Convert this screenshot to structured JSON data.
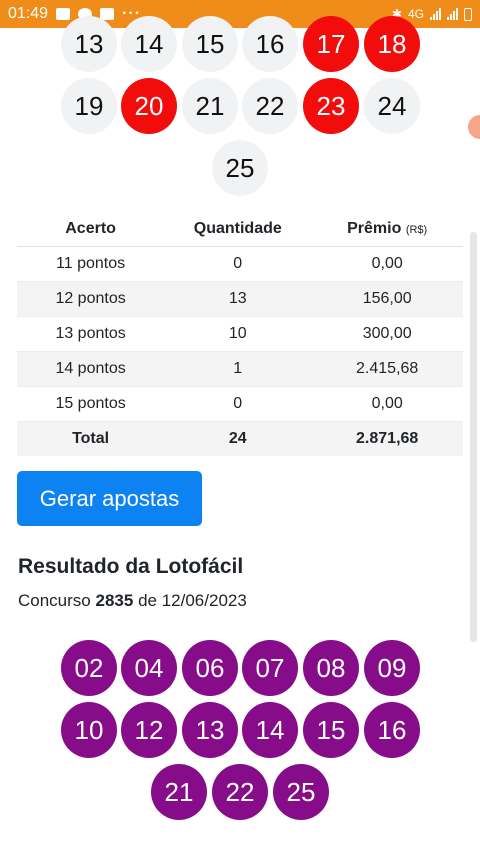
{
  "status_bar": {
    "time": "01:49",
    "network": "4G"
  },
  "top_balls": [
    {
      "n": "13",
      "drawn": false
    },
    {
      "n": "14",
      "drawn": false
    },
    {
      "n": "15",
      "drawn": false
    },
    {
      "n": "16",
      "drawn": false
    },
    {
      "n": "17",
      "drawn": true
    },
    {
      "n": "18",
      "drawn": true
    },
    {
      "n": "19",
      "drawn": false
    },
    {
      "n": "20",
      "drawn": true
    },
    {
      "n": "21",
      "drawn": false
    },
    {
      "n": "22",
      "drawn": false
    },
    {
      "n": "23",
      "drawn": true
    },
    {
      "n": "24",
      "drawn": false
    },
    {
      "n": "25",
      "drawn": false
    }
  ],
  "prize_table": {
    "headers": {
      "acerto": "Acerto",
      "quantidade": "Quantidade",
      "premio": "Prêmio",
      "unit": "(R$)"
    },
    "rows": [
      {
        "acerto": "11 pontos",
        "quantidade": "0",
        "premio": "0,00"
      },
      {
        "acerto": "12 pontos",
        "quantidade": "13",
        "premio": "156,00"
      },
      {
        "acerto": "13 pontos",
        "quantidade": "10",
        "premio": "300,00"
      },
      {
        "acerto": "14 pontos",
        "quantidade": "1",
        "premio": "2.415,68"
      },
      {
        "acerto": "15 pontos",
        "quantidade": "0",
        "premio": "0,00"
      }
    ],
    "total": {
      "label": "Total",
      "quantidade": "24",
      "premio": "2.871,68"
    }
  },
  "generate_button": {
    "label": "Gerar apostas"
  },
  "result": {
    "title": "Resultado da Lotofácil",
    "prefix": "Concurso",
    "contest": "2835",
    "date_prefix": "de",
    "date": "12/06/2023",
    "numbers": [
      "02",
      "04",
      "06",
      "07",
      "08",
      "09",
      "10",
      "12",
      "13",
      "14",
      "15",
      "16",
      "21",
      "22",
      "25"
    ]
  },
  "colors": {
    "status_bar": "#ef8c1a",
    "drawn_ball": "#f20c0c",
    "result_ball": "#860c8a",
    "button": "#0d82f3"
  }
}
